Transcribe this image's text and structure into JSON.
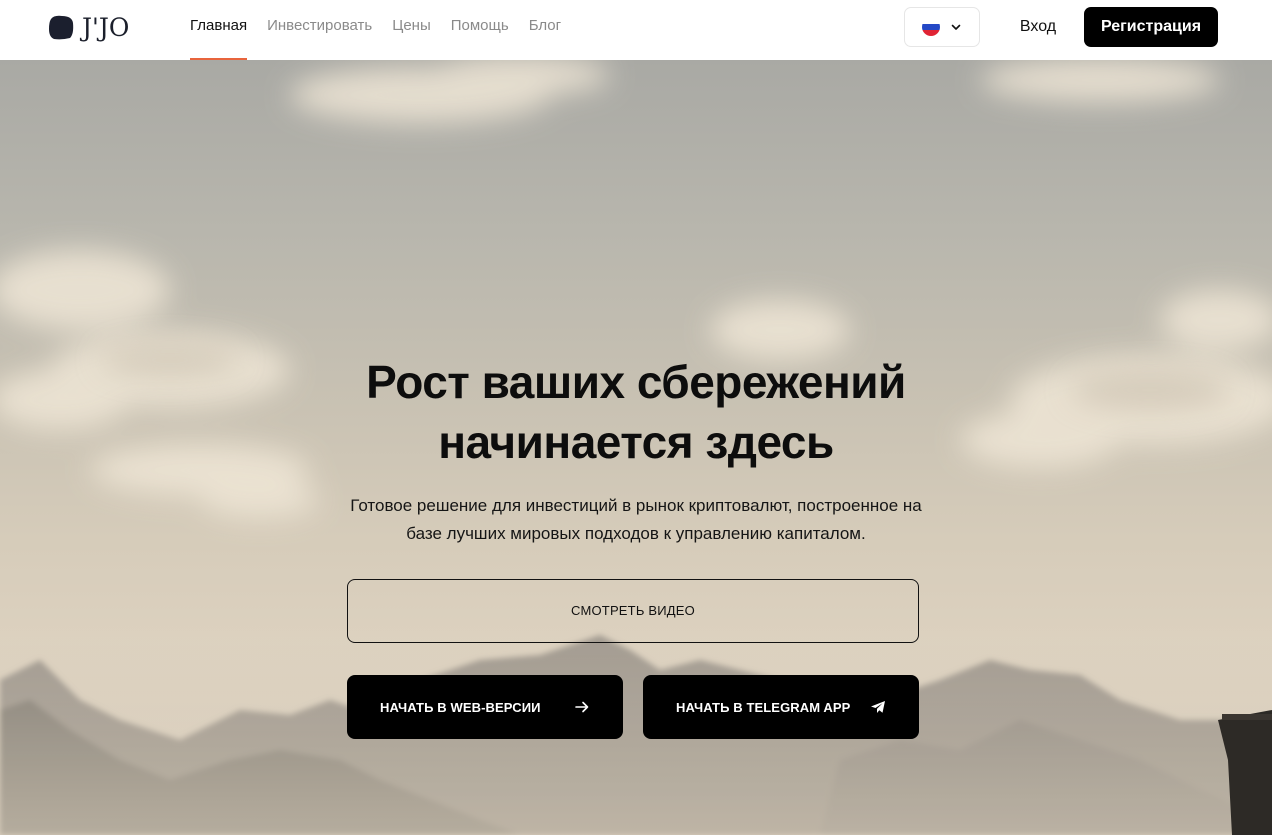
{
  "brand": {
    "name": "J'JO"
  },
  "nav": {
    "items": [
      {
        "label": "Главная",
        "active": true
      },
      {
        "label": "Инвестировать",
        "active": false
      },
      {
        "label": "Цены",
        "active": false
      },
      {
        "label": "Помощь",
        "active": false
      },
      {
        "label": "Блог",
        "active": false
      }
    ],
    "accent_color": "#e8643c"
  },
  "language": {
    "icon": "russia-flag-icon",
    "dropdown_icon": "chevron-down-icon"
  },
  "auth": {
    "login_label": "Вход",
    "signup_label": "Регистрация"
  },
  "hero": {
    "title_line1": "Рост ваших сбережений",
    "title_line2": "начинается здесь",
    "subtitle": "Готовое решение для инвестиций в рынок криптовалют, построенное на базе лучших мировых подходов к управлению капиталом.",
    "video_button": "СМОТРЕТЬ ВИДЕО",
    "web_button": "НАЧАТЬ В WEB-ВЕРСИИ",
    "web_icon": "arrow-right-icon",
    "telegram_button": "НАЧАТЬ В TELEGRAM APP",
    "telegram_icon": "telegram-icon"
  }
}
